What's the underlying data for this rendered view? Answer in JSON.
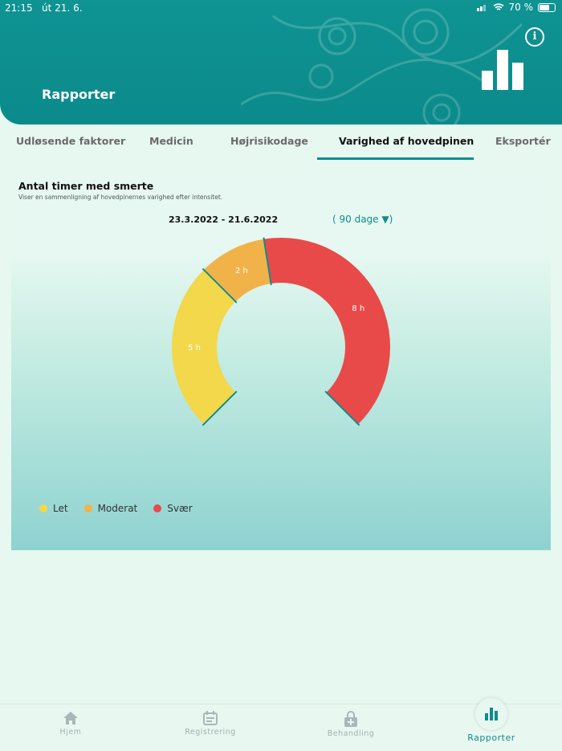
{
  "status": {
    "time": "21:15",
    "date": "út 21. 6.",
    "battery": "70 %"
  },
  "header": {
    "title": "Rapporter"
  },
  "tabs": [
    {
      "label": "Udløsende faktorer",
      "active": false
    },
    {
      "label": "Medicin",
      "active": false
    },
    {
      "label": "Højrisikodage",
      "active": false
    },
    {
      "label": "Varighed af hovedpinen",
      "active": true
    },
    {
      "label": "Eksportér",
      "active": false
    }
  ],
  "report": {
    "title": "Antal timer med smerte",
    "subtitle": "Viser en sammenligning af hovedpinernes varighed efter intensitet.",
    "range": "23.3.2022 - 21.6.2022",
    "period": "( 90 dage  ▼)"
  },
  "chart_data": {
    "type": "pie",
    "style": "gauge",
    "categories": [
      "Let",
      "Moderat",
      "Svær"
    ],
    "values": [
      5,
      2,
      8
    ],
    "labels": [
      "5 h",
      "2 h",
      "8 h"
    ],
    "colors": [
      "#f2d84a",
      "#f2b24a",
      "#e84a4a"
    ],
    "legend": "bottom-left"
  },
  "nav": [
    {
      "label": "Hjem",
      "icon": "home-icon",
      "active": false
    },
    {
      "label": "Registrering",
      "icon": "calendar-icon",
      "active": false
    },
    {
      "label": "Behandling",
      "icon": "lock-plus-icon",
      "active": false
    },
    {
      "label": "Rapporter",
      "icon": "bar-chart-icon",
      "active": true
    }
  ]
}
